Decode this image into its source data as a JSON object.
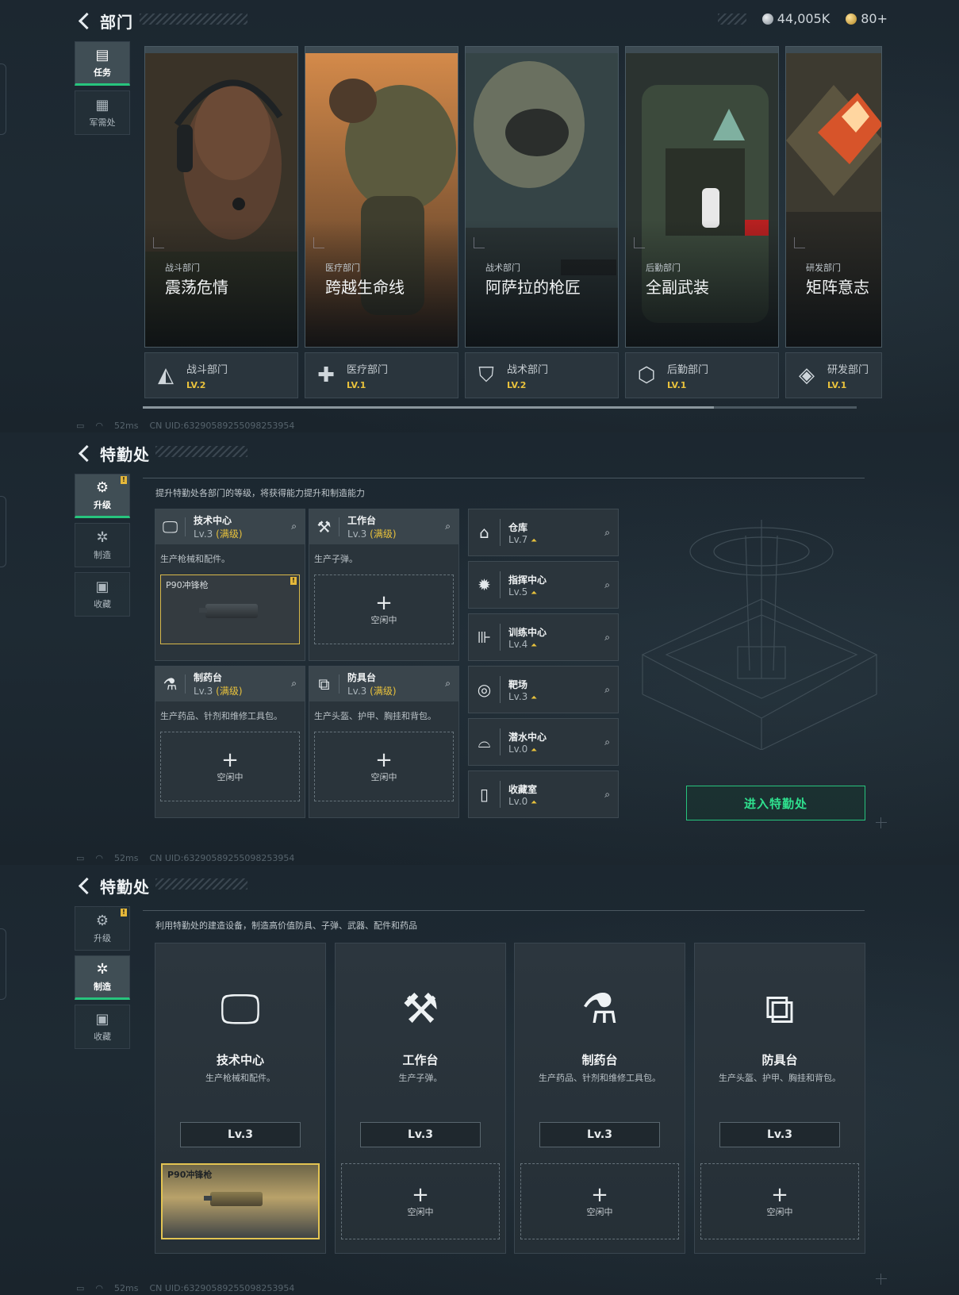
{
  "panel1": {
    "title": "部门",
    "currency": {
      "silver": "44,005K",
      "gold": "80+"
    },
    "nav": [
      {
        "label": "任务",
        "icon": "mission-icon",
        "active": true
      },
      {
        "label": "军需处",
        "icon": "supply-icon",
        "active": false
      }
    ],
    "departments": [
      {
        "sub": "战斗部门",
        "name": "震荡危情",
        "dept": "战斗部门",
        "level": "LV.2",
        "icon": "combat-dept-icon"
      },
      {
        "sub": "医疗部门",
        "name": "跨越生命线",
        "dept": "医疗部门",
        "level": "LV.1",
        "icon": "medical-dept-icon"
      },
      {
        "sub": "战术部门",
        "name": "阿萨拉的枪匠",
        "dept": "战术部门",
        "level": "LV.2",
        "icon": "tactical-dept-icon"
      },
      {
        "sub": "后勤部门",
        "name": "全副武装",
        "dept": "后勤部门",
        "level": "LV.1",
        "icon": "logistics-dept-icon"
      },
      {
        "sub": "研发部门",
        "name": "矩阵意志",
        "dept": "研发部门",
        "level": "LV.1",
        "icon": "rnd-dept-icon"
      }
    ],
    "status": {
      "ping": "52ms",
      "uid": "CN UID:6329058925509825395​4"
    }
  },
  "panel2": {
    "title": "特勤处",
    "nav": [
      {
        "label": "升级",
        "active": true
      },
      {
        "label": "制造",
        "active": false
      },
      {
        "label": "收藏",
        "active": false
      }
    ],
    "description": "提升特勤处各部门的等级，将获得能力提升和制造能力",
    "facilities": [
      {
        "name": "技术中心",
        "level": "Lv.3",
        "max": "(满级)",
        "desc": "生产枪械和配件。",
        "slot": "P90冲锋枪"
      },
      {
        "name": "工作台",
        "level": "Lv.3",
        "max": "(满级)",
        "desc": "生产子弹。",
        "slot": "空闲中"
      },
      {
        "name": "制药台",
        "level": "Lv.3",
        "max": "(满级)",
        "desc": "生产药品、针剂和维修工具包。",
        "slot": "空闲中"
      },
      {
        "name": "防具台",
        "level": "Lv.3",
        "max": "(满级)",
        "desc": "生产头盔、护甲、胸挂和背包。",
        "slot": "空闲中"
      }
    ],
    "rooms": [
      {
        "name": "仓库",
        "level": "Lv.7"
      },
      {
        "name": "指挥中心",
        "level": "Lv.5"
      },
      {
        "name": "训练中心",
        "level": "Lv.4"
      },
      {
        "name": "靶场",
        "level": "Lv.3"
      },
      {
        "name": "潜水中心",
        "level": "Lv.0"
      },
      {
        "name": "收藏室",
        "level": "Lv.0"
      }
    ],
    "enter_label": "进入特勤处",
    "status": {
      "ping": "52ms",
      "uid": "CN UID:6329058925509825395​4"
    }
  },
  "panel3": {
    "title": "特勤处",
    "nav": [
      {
        "label": "升级",
        "active": false
      },
      {
        "label": "制造",
        "active": true
      },
      {
        "label": "收藏",
        "active": false
      }
    ],
    "description": "利用特勤处的建造设备，制造高价值防具、子弹、武器、配件和药品",
    "cards": [
      {
        "name": "技术中心",
        "desc": "生产枪械和配件。",
        "level": "Lv.3",
        "slot": "P90冲锋枪"
      },
      {
        "name": "工作台",
        "desc": "生产子弹。",
        "level": "Lv.3",
        "slot": "空闲中"
      },
      {
        "name": "制药台",
        "desc": "生产药品、针剂和维修工具包。",
        "level": "Lv.3",
        "slot": "空闲中"
      },
      {
        "name": "防具台",
        "desc": "生产头盔、护甲、胸挂和背包。",
        "level": "Lv.3",
        "slot": "空闲中"
      }
    ],
    "status": {
      "ping": "52ms",
      "uid": "CN UID:6329058925509825395​4"
    }
  },
  "colors": {
    "accent_green": "#27c47d",
    "level_gold": "#e9c23c",
    "badge_yellow": "#e5b83a"
  }
}
